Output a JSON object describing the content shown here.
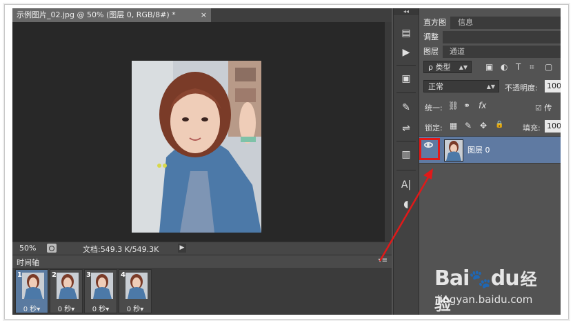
{
  "document": {
    "tab_title": "示例图片_02.jpg @ 50% (图层 0, RGB/8#) *",
    "close_glyph": "×"
  },
  "status": {
    "zoom": "50%",
    "doc_size": "文档:549.3 K/549.3K",
    "arrow": "▶"
  },
  "timeline": {
    "title": "时间轴",
    "menu_glyph": "▾≡",
    "frames": [
      {
        "num": "1",
        "duration": "0 秒▾"
      },
      {
        "num": "2",
        "duration": "0 秒▾"
      },
      {
        "num": "3",
        "duration": "0 秒▾"
      },
      {
        "num": "4",
        "duration": "0 秒▾"
      }
    ]
  },
  "tool_strip": {
    "collapse": "◂◂",
    "tools": [
      "history-icon",
      "play-icon",
      "info-icon",
      "brush-icon",
      "sliders-icon",
      "stamp-icon",
      "type-icon",
      "comment-icon"
    ],
    "glyphs": [
      "▤",
      "▶",
      "▣",
      "✎",
      "⇌",
      "▥",
      "A|",
      "◖"
    ]
  },
  "panels": {
    "top_tabs": [
      "直方图",
      "信息"
    ],
    "adjust_tab": "调整",
    "layer_tabs": [
      "图层",
      "通道"
    ],
    "filter_kind": "ρ 类型",
    "filter_icons": [
      "▣",
      "◐",
      "T",
      "⌗",
      "▢"
    ],
    "blend_mode": "正常",
    "opacity_label": "不透明度:",
    "opacity_value": "100",
    "unify_label": "统一:",
    "unify_icons": [
      "⛓",
      "⚭",
      "fx"
    ],
    "propagate_label": "☑ 传",
    "lock_label": "锁定:",
    "lock_icons": [
      "▦",
      "✎",
      "✥",
      "🔒"
    ],
    "fill_label": "填充:",
    "fill_value": "100",
    "layer_name": "图层 0"
  },
  "watermark": {
    "logo_a": "Bai",
    "logo_b": "du",
    "logo_c": "经验",
    "url": "jingyan.baidu.com"
  },
  "colors": {
    "highlight_box": "#e11919",
    "arrow": "#e11919",
    "selected_layer": "#5f7aa2"
  }
}
